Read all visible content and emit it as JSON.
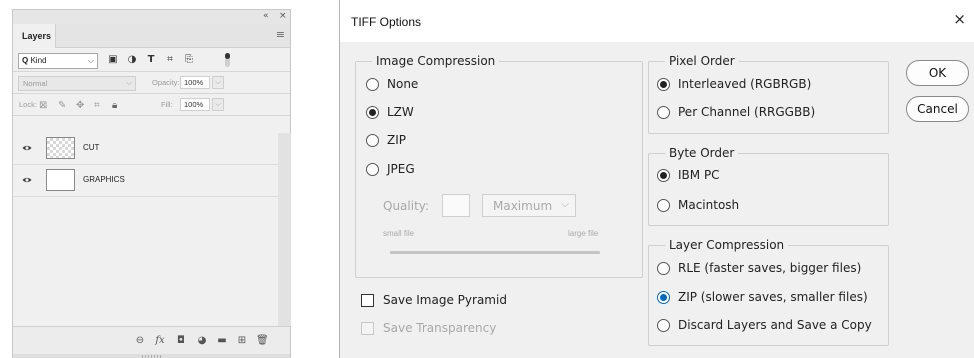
{
  "layers_panel": {
    "collapse_label": "«",
    "close_label": "×",
    "tab_label": "Layers",
    "menu_label": "≡",
    "filter_kind": "Kind",
    "blend_mode": "Normal",
    "opacity_label": "Opacity:",
    "opacity_value": "100%",
    "lock_label": "Lock:",
    "fill_label": "Fill:",
    "fill_value": "100%",
    "layers": [
      {
        "name": "CUT",
        "thumbnail": "transparent"
      },
      {
        "name": "GRAPHICS",
        "thumbnail": "white"
      }
    ],
    "bottom_icons": [
      "link-icon",
      "fx-icon",
      "mask-icon",
      "adjustment-icon",
      "folder-icon",
      "new-layer-icon",
      "trash-icon"
    ],
    "fx_label": "fx"
  },
  "tiff_dialog": {
    "title": "TIFF Options",
    "close_label": "×",
    "image_compression": {
      "legend": "Image Compression",
      "options": [
        "None",
        "LZW",
        "ZIP",
        "JPEG"
      ],
      "selected": "LZW",
      "quality_label": "Quality:",
      "quality_value": "",
      "quality_preset": "Maximum",
      "small_file_label": "small file",
      "large_file_label": "large file"
    },
    "pixel_order": {
      "legend": "Pixel Order",
      "options": [
        "Interleaved (RGBRGB)",
        "Per Channel (RRGGBB)"
      ],
      "selected": "Interleaved (RGBRGB)"
    },
    "byte_order": {
      "legend": "Byte Order",
      "options": [
        "IBM PC",
        "Macintosh"
      ],
      "selected": "IBM PC"
    },
    "layer_compression": {
      "legend": "Layer Compression",
      "options": [
        "RLE (faster saves, bigger files)",
        "ZIP (slower saves, smaller files)",
        "Discard Layers and Save a Copy"
      ],
      "selected": "ZIP (slower saves, smaller files)"
    },
    "save_image_pyramid": {
      "label": "Save Image Pyramid",
      "checked": false
    },
    "save_transparency": {
      "label": "Save Transparency",
      "checked": false,
      "disabled": true
    },
    "ok_label": "OK",
    "cancel_label": "Cancel",
    "accent_color": "#0067c0"
  }
}
